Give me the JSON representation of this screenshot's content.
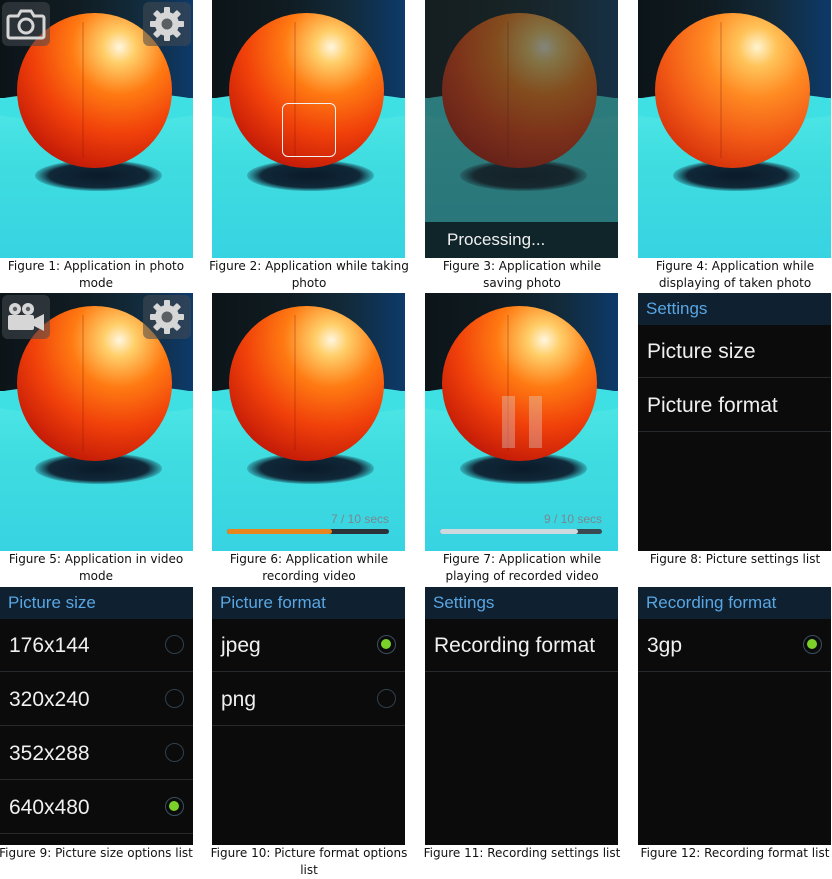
{
  "figures": {
    "f1": "Figure 1: Application in photo mode",
    "f2": "Figure 2: Application while taking photo",
    "f3": "Figure 3: Application while saving photo",
    "f4": "Figure 4: Application while displaying of taken photo",
    "f5": "Figure 5: Application in video mode",
    "f6": "Figure 6: Application while recording video",
    "f7": "Figure 7: Application while playing of recorded video",
    "f8": "Figure 8: Picture settings list",
    "f9": "Figure 9: Picture size options list",
    "f10": "Figure 10: Picture format options list",
    "f11": "Figure 11: Recording settings list",
    "f12": "Figure 12: Recording format list"
  },
  "screen3": {
    "processing_text": "Processing..."
  },
  "screen6": {
    "label": "7 / 10 secs",
    "progress": 0.65,
    "fill_color": "#e8851d"
  },
  "screen7": {
    "label": "9 / 10 secs",
    "progress": 0.85,
    "fill_color": "#cfd8dc"
  },
  "screen8": {
    "header": "Settings",
    "items": [
      "Picture size",
      "Picture format"
    ]
  },
  "screen9": {
    "header": "Picture size",
    "options": [
      {
        "label": "176x144",
        "selected": false
      },
      {
        "label": "320x240",
        "selected": false
      },
      {
        "label": "352x288",
        "selected": false
      },
      {
        "label": "640x480",
        "selected": true
      }
    ]
  },
  "screen10": {
    "header": "Picture format",
    "options": [
      {
        "label": "jpeg",
        "selected": true
      },
      {
        "label": "png",
        "selected": false
      }
    ]
  },
  "screen11": {
    "header": "Settings",
    "items": [
      "Recording format"
    ]
  },
  "screen12": {
    "header": "Recording format",
    "options": [
      {
        "label": "3gp",
        "selected": true
      }
    ]
  },
  "icons": {
    "photo_mode": "camera-icon",
    "video_mode": "video-camera-icon",
    "settings": "gear-icon"
  },
  "colors": {
    "accent_header": "#59a6e3",
    "radio_selected": "#7bd02a"
  }
}
